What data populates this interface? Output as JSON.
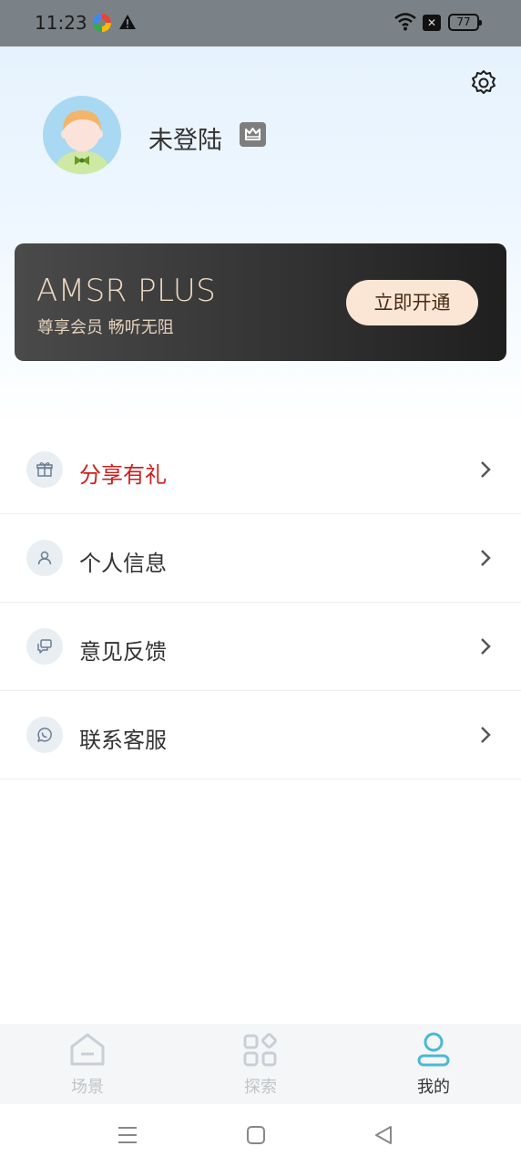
{
  "status_bar": {
    "time": "11:23",
    "battery": "77",
    "icons": [
      "app-icon",
      "warning-icon",
      "wifi-icon",
      "sim-icon",
      "battery-icon"
    ]
  },
  "profile": {
    "username": "未登陆",
    "avatar_icon": "boy-avatar",
    "badge_icon": "crown-icon",
    "settings_icon": "gear-icon"
  },
  "vip_card": {
    "title": "AMSR PLUS",
    "subtitle": "尊享会员 畅听无阻",
    "button": "立即开通"
  },
  "menu": {
    "items": [
      {
        "label": "分享有礼",
        "icon": "gift-icon",
        "color": "#cc1f1f"
      },
      {
        "label": "个人信息",
        "icon": "person-icon"
      },
      {
        "label": "意见反馈",
        "icon": "feedback-icon"
      },
      {
        "label": "联系客服",
        "icon": "whatsapp-phone-icon"
      }
    ]
  },
  "tabbar": {
    "tabs": [
      {
        "label": "场景",
        "icon": "home-icon",
        "active": false
      },
      {
        "label": "探索",
        "icon": "grid-icon",
        "active": false
      },
      {
        "label": "我的",
        "icon": "user-icon",
        "active": true
      }
    ],
    "accent": "#4bb8d6"
  },
  "system_nav": {
    "icons": [
      "menu-lines-icon",
      "square-home-icon",
      "triangle-back-icon"
    ]
  }
}
